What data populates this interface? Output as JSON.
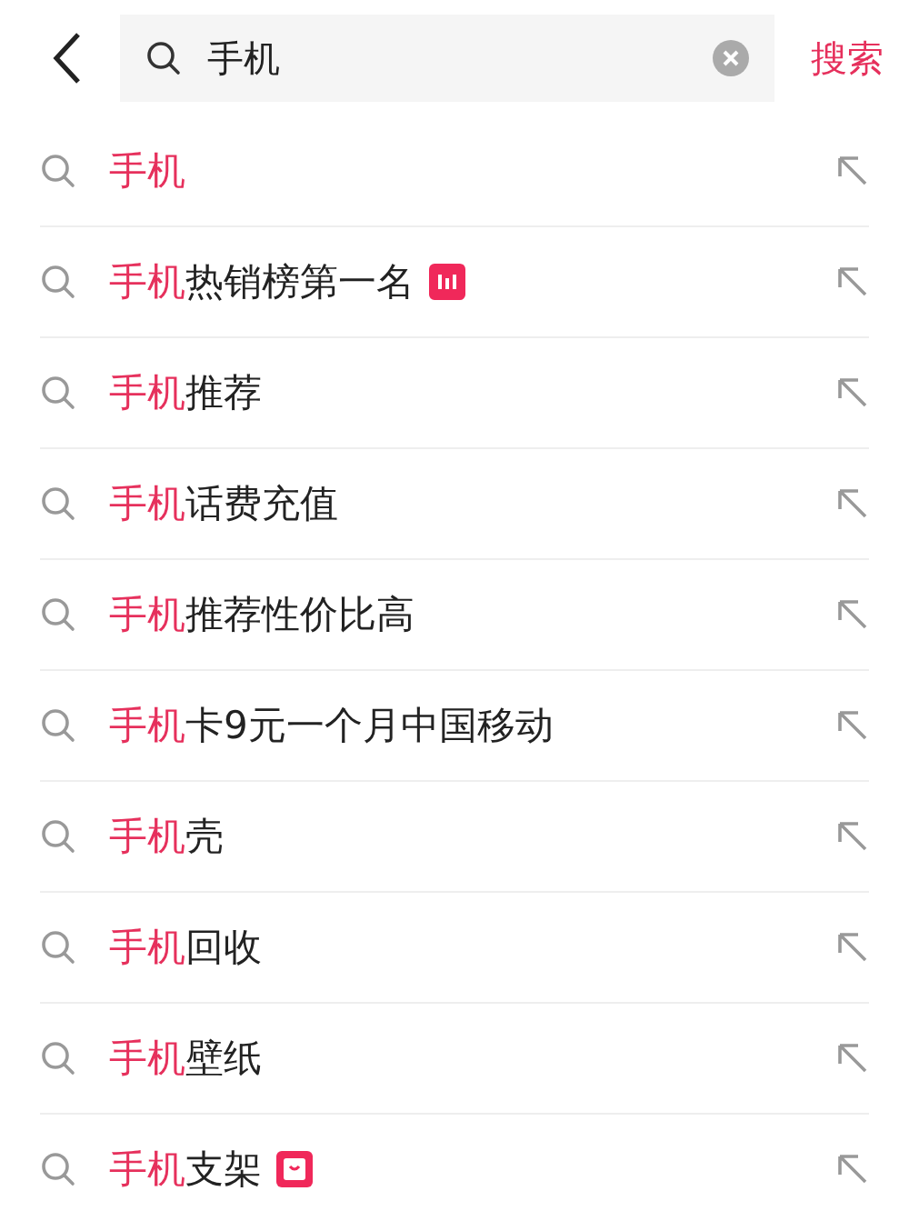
{
  "search_bar": {
    "query": "手机",
    "action": "搜索"
  },
  "suggestions": [
    {
      "match": "手机",
      "kind": "plain"
    },
    {
      "match": "手机",
      "rest": "热销榜第一名",
      "kind": "chart"
    },
    {
      "match": "手机",
      "rest": "推荐",
      "kind": "plain"
    },
    {
      "match": "手机",
      "rest": "话费充值",
      "kind": "plain"
    },
    {
      "match": "手机",
      "rest": "推荐性价比高",
      "kind": "plain"
    },
    {
      "match": "手机",
      "rest": "卡9元一个月中国移动",
      "kind": "plain"
    },
    {
      "match": "手机",
      "rest": "壳",
      "kind": "plain"
    },
    {
      "match": "手机",
      "rest": "回收",
      "kind": "plain"
    },
    {
      "match": "手机",
      "rest": "壁纸",
      "kind": "plain"
    },
    {
      "match": "手机",
      "rest": "支架",
      "kind": "bag"
    }
  ]
}
